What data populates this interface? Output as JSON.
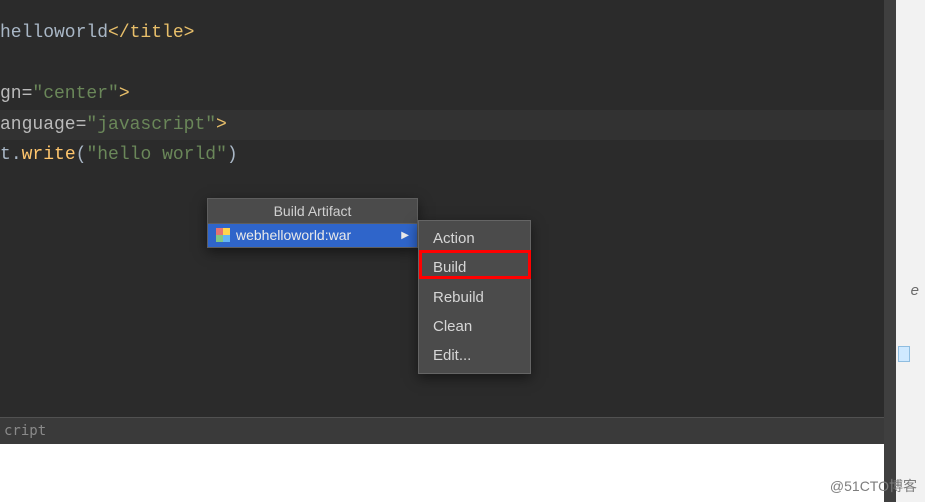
{
  "code": {
    "line1_pre": "helloworld",
    "line1_close": "</title>",
    "line2_attr": "gn=",
    "line2_val": "\"center\"",
    "line2_end": ">",
    "line3_attr": "anguage=",
    "line3_val": "\"javascript\"",
    "line3_end": ">",
    "line4_obj": "t",
    "line4_dot": ".",
    "line4_fn": "write",
    "line4_open": "(",
    "line4_arg": "\"hello world\"",
    "line4_close": ")"
  },
  "artifact_popup": {
    "header": "Build Artifact",
    "item_label": "webhelloworld:war",
    "arrow": "▶"
  },
  "actions": {
    "action": "Action",
    "build": "Build",
    "rebuild": "Rebuild",
    "clean": "Clean",
    "edit": "Edit..."
  },
  "footer": {
    "text": "cript"
  },
  "right": {
    "glyph": "e"
  },
  "watermark": "@51CTO博客"
}
